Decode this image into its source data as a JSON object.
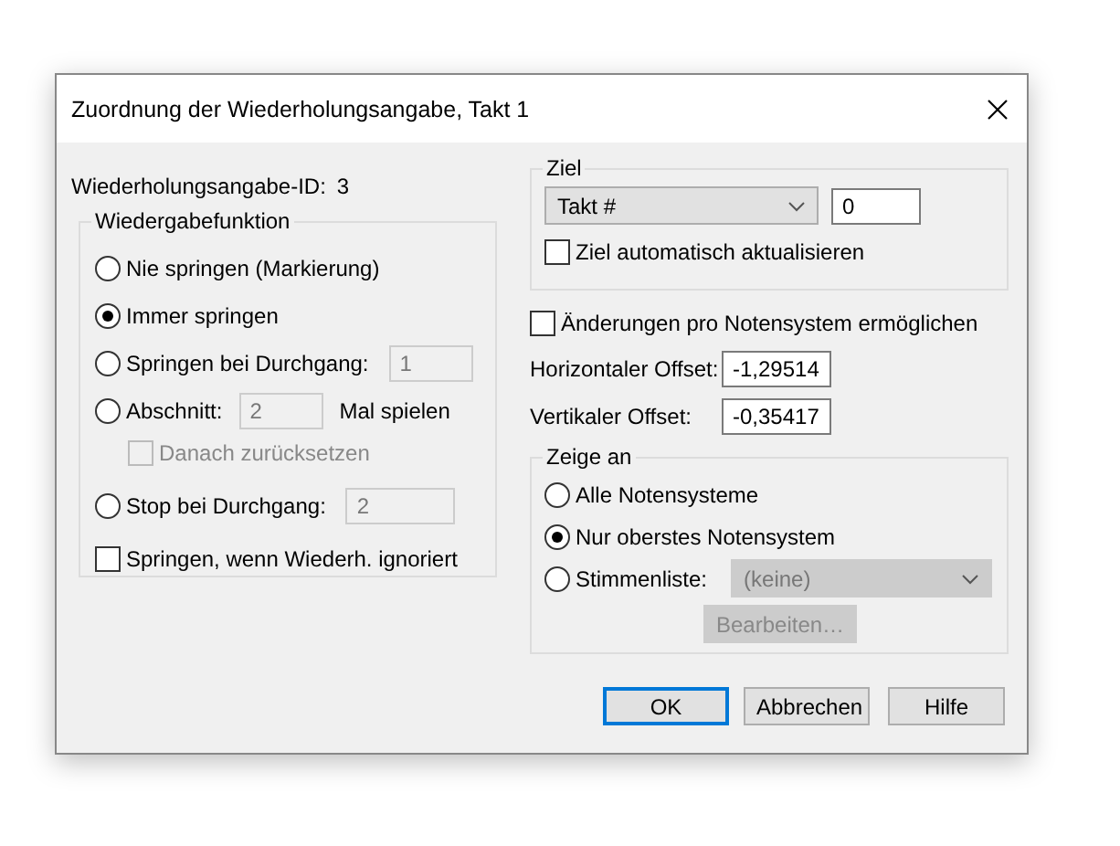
{
  "window": {
    "title": "Zuordnung der Wiederholungsangabe, Takt 1"
  },
  "id_label": "Wiederholungsangabe-ID:",
  "id_value": "3",
  "playback": {
    "title": "Wiedergabefunktion",
    "options": [
      {
        "kind": "radio",
        "label": "Nie springen (Markierung)",
        "selected": false
      },
      {
        "kind": "radio",
        "label": "Immer springen",
        "selected": true
      },
      {
        "kind": "radio_field",
        "label": "Springen bei Durchgang:",
        "selected": false,
        "value": "1",
        "disabled": true
      },
      {
        "kind": "radio_field",
        "label": "Abschnitt:",
        "selected": false,
        "value": "2",
        "suffix": "Mal spielen",
        "disabled": true
      },
      {
        "kind": "sub_checkbox",
        "label": "Danach zurücksetzen",
        "checked": false,
        "disabled": true
      },
      {
        "kind": "radio_field",
        "label": "Stop bei Durchgang:",
        "selected": false,
        "value": "2",
        "disabled": true
      },
      {
        "kind": "checkbox",
        "label": "Springen, wenn Wiederh. ignoriert",
        "checked": false
      }
    ]
  },
  "target": {
    "title": "Ziel",
    "dropdown": "Takt #",
    "value": "0",
    "auto_update": {
      "label": "Ziel automatisch aktualisieren",
      "checked": false
    }
  },
  "per_staff": {
    "label": "Änderungen pro Notensystem ermöglichen",
    "checked": false
  },
  "offsets": [
    {
      "label": "Horizontaler Offset:",
      "value": "-1,29514"
    },
    {
      "label": "Vertikaler Offset:",
      "value": "-0,35417"
    }
  ],
  "show": {
    "title": "Zeige an",
    "options": [
      {
        "label": "Alle Notensysteme",
        "selected": false
      },
      {
        "label": "Nur oberstes Notensystem",
        "selected": true
      },
      {
        "label": "Stimmenliste:",
        "selected": false
      }
    ],
    "voice_dropdown": {
      "value": "(keine)",
      "disabled": true
    },
    "edit_button": {
      "label": "Bearbeiten…",
      "disabled": true
    }
  },
  "buttons": [
    {
      "label": "OK",
      "default": true
    },
    {
      "label": "Abbrechen",
      "default": false
    },
    {
      "label": "Hilfe",
      "default": false
    }
  ]
}
